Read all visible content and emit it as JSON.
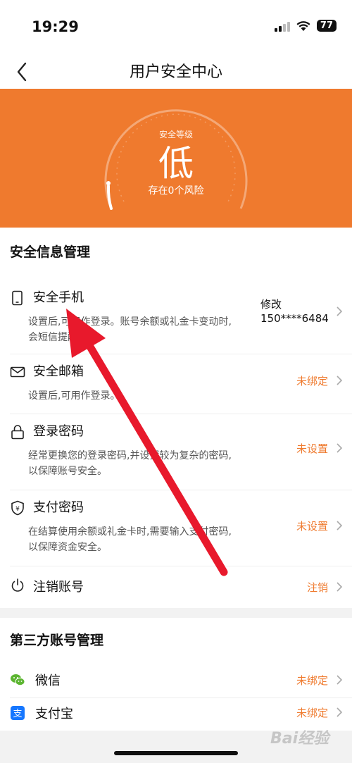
{
  "status_bar": {
    "time": "19:29",
    "battery": "77"
  },
  "nav": {
    "title": "用户安全中心"
  },
  "hero": {
    "level_caption": "安全等级",
    "level_value": "低",
    "risk_text": "存在0个风险",
    "background_color": "#ef7a2e"
  },
  "security_section": {
    "title": "安全信息管理",
    "items": [
      {
        "title": "安全手机",
        "icon": "phone-icon",
        "desc": "设置后,可用作登录。账号余额或礼金卡变动时,会短信提醒您。",
        "action": "修改",
        "value": "150****6484"
      },
      {
        "title": "安全邮箱",
        "icon": "mail-icon",
        "desc": "设置后,可用作登录。",
        "status": "未绑定"
      },
      {
        "title": "登录密码",
        "icon": "lock-icon",
        "desc": "经常更换您的登录密码,并设置较为复杂的密码,以保障账号安全。",
        "status": "未设置"
      },
      {
        "title": "支付密码",
        "icon": "shield-icon",
        "desc": "在结算使用余额或礼金卡时,需要输入支付密码,以保障资金安全。",
        "status": "未设置"
      },
      {
        "title": "注销账号",
        "icon": "power-icon",
        "status": "注销"
      }
    ]
  },
  "third_party_section": {
    "title": "第三方账号管理",
    "items": [
      {
        "title": "微信",
        "icon": "wechat-icon",
        "status": "未绑定"
      },
      {
        "title": "支付宝",
        "icon": "alipay-icon",
        "status": "未绑定"
      }
    ]
  },
  "watermark": "Bai经验",
  "colors": {
    "accent": "#ef7a2e",
    "arrow": "#e8192c"
  }
}
